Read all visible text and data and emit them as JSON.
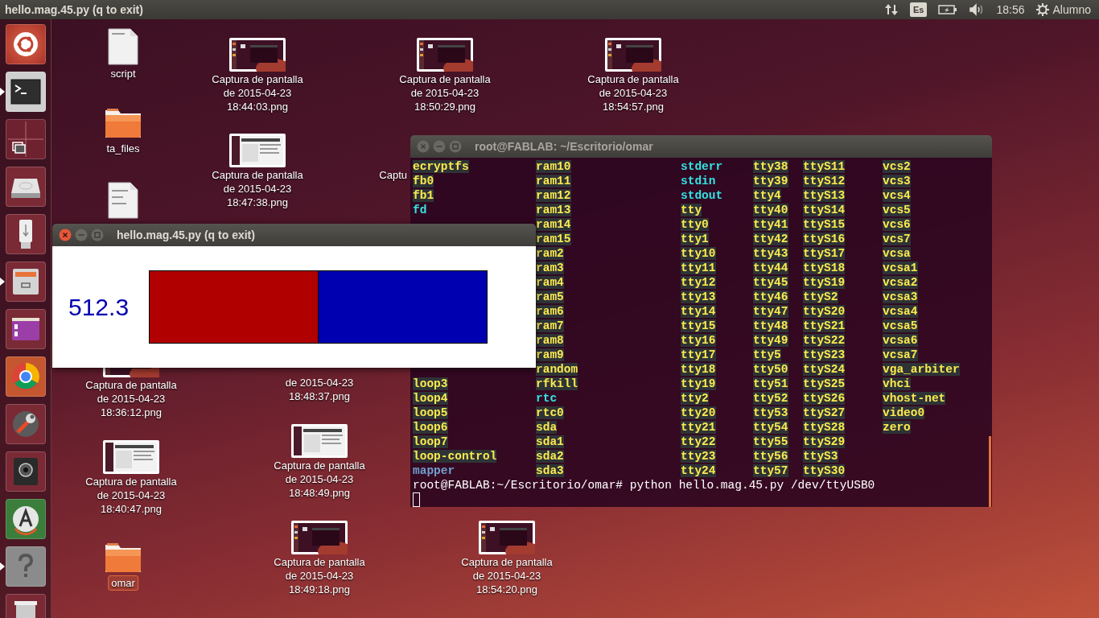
{
  "top_panel": {
    "title": "hello.mag.45.py (q to exit)",
    "keyboard_layout": "Es",
    "clock": "18:56",
    "user": "Alumno"
  },
  "launcher": [
    {
      "kind": "dash",
      "running": false
    },
    {
      "kind": "terminal",
      "running": true
    },
    {
      "kind": "workspaces",
      "running": false
    },
    {
      "kind": "drive",
      "running": false
    },
    {
      "kind": "usb",
      "running": false
    },
    {
      "kind": "files",
      "running": true
    },
    {
      "kind": "purple",
      "running": false
    },
    {
      "kind": "browser",
      "running": false
    },
    {
      "kind": "settings",
      "running": false
    },
    {
      "kind": "camera",
      "running": false
    },
    {
      "kind": "updater",
      "running": false
    },
    {
      "kind": "help",
      "running": true
    },
    {
      "kind": "trash",
      "running": false
    }
  ],
  "desktop_icons": [
    {
      "kind": "file",
      "label": "script",
      "selected": false
    },
    {
      "kind": "folder",
      "label": "ta_files",
      "selected": false
    },
    {
      "kind": "html"
    },
    {
      "kind": "screenshot",
      "label": "Captura de pantalla\nde 2015-04-23\n18:44:03.png",
      "selected": false
    },
    {
      "kind": "screenshot",
      "label": "Captura de pantalla\nde 2015-04-23\n18:47:38.png",
      "selected": false
    },
    {
      "kind": "screenshot",
      "label": "Captura de pantalla\nde 2015-04-23\n18:50:29.png",
      "selected": false
    },
    {
      "kind": "screenshot",
      "label": "Captura de pantalla\nde 2015-04-23\n18:54:57.png",
      "selected": false
    },
    {
      "kind": "partial",
      "label": "Captu",
      "selected": false
    },
    {
      "kind": "screenshot",
      "label": "Captura de pantalla\nde 2015-04-23\n18:36:12.png",
      "selected": false
    },
    {
      "kind": "label",
      "label": "de 2015-04-23\n18:48:37.png",
      "selected": false
    },
    {
      "kind": "screenshot",
      "label": "Captura de pantalla\nde 2015-04-23\n18:40:47.png",
      "selected": false
    },
    {
      "kind": "screenshot",
      "label": "Captura de pantalla\nde 2015-04-23\n18:48:49.png",
      "selected": false
    },
    {
      "kind": "folder",
      "label": "omar",
      "selected": true
    },
    {
      "kind": "screenshot",
      "label": "Captura de pantalla\nde 2015-04-23\n18:49:18.png",
      "selected": false
    },
    {
      "kind": "screenshot",
      "label": "Captura de pantalla\nde 2015-04-23\n18:54:20.png",
      "selected": false
    }
  ],
  "terminal_window": {
    "title": "root@FABLAB: ~/Escritorio/omar",
    "columns": [
      {
        "top": [
          {
            "name": "ecryptfs",
            "kind": "device"
          },
          {
            "name": "fb0",
            "kind": "device"
          },
          {
            "name": "fb1",
            "kind": "device"
          },
          {
            "name": "fd",
            "kind": "link"
          }
        ],
        "bottom": [
          {
            "name": "loop3",
            "kind": "device"
          },
          {
            "name": "loop4",
            "kind": "device"
          },
          {
            "name": "loop5",
            "kind": "device"
          },
          {
            "name": "loop6",
            "kind": "device"
          },
          {
            "name": "loop7",
            "kind": "device"
          },
          {
            "name": "loop-control",
            "kind": "device"
          },
          {
            "name": "mapper",
            "kind": "dir"
          }
        ]
      },
      {
        "top": [
          {
            "name": "ram10",
            "kind": "device"
          },
          {
            "name": "ram11",
            "kind": "device"
          },
          {
            "name": "ram12",
            "kind": "device"
          },
          {
            "name": "ram13",
            "kind": "device"
          },
          {
            "name": "ram14",
            "kind": "device"
          },
          {
            "name": "ram15",
            "kind": "device"
          },
          {
            "name": "ram2",
            "kind": "device"
          },
          {
            "name": "ram3",
            "kind": "device"
          },
          {
            "name": "ram4",
            "kind": "device"
          },
          {
            "name": "ram5",
            "kind": "device"
          },
          {
            "name": "ram6",
            "kind": "device"
          },
          {
            "name": "ram7",
            "kind": "device"
          },
          {
            "name": "ram8",
            "kind": "device"
          },
          {
            "name": "ram9",
            "kind": "device"
          },
          {
            "name": "random",
            "kind": "device"
          },
          {
            "name": "rfkill",
            "kind": "device"
          },
          {
            "name": "rtc",
            "kind": "link"
          },
          {
            "name": "rtc0",
            "kind": "device"
          },
          {
            "name": "sda",
            "kind": "device"
          },
          {
            "name": "sda1",
            "kind": "device"
          },
          {
            "name": "sda2",
            "kind": "device"
          },
          {
            "name": "sda3",
            "kind": "device"
          }
        ]
      },
      {
        "top": [
          {
            "name": "stderr",
            "kind": "link"
          },
          {
            "name": "stdin",
            "kind": "link"
          },
          {
            "name": "stdout",
            "kind": "link"
          },
          {
            "name": "tty",
            "kind": "device"
          },
          {
            "name": "tty0",
            "kind": "device"
          },
          {
            "name": "tty1",
            "kind": "device"
          },
          {
            "name": "tty10",
            "kind": "device"
          },
          {
            "name": "tty11",
            "kind": "device"
          },
          {
            "name": "tty12",
            "kind": "device"
          },
          {
            "name": "tty13",
            "kind": "device"
          },
          {
            "name": "tty14",
            "kind": "device"
          },
          {
            "name": "tty15",
            "kind": "device"
          },
          {
            "name": "tty16",
            "kind": "device"
          },
          {
            "name": "tty17",
            "kind": "device"
          },
          {
            "name": "tty18",
            "kind": "device"
          },
          {
            "name": "tty19",
            "kind": "device"
          },
          {
            "name": "tty2",
            "kind": "device"
          },
          {
            "name": "tty20",
            "kind": "device"
          },
          {
            "name": "tty21",
            "kind": "device"
          },
          {
            "name": "tty22",
            "kind": "device"
          },
          {
            "name": "tty23",
            "kind": "device"
          },
          {
            "name": "tty24",
            "kind": "device"
          }
        ]
      },
      {
        "top": [
          {
            "name": "tty38",
            "kind": "device"
          },
          {
            "name": "tty39",
            "kind": "device"
          },
          {
            "name": "tty4",
            "kind": "device"
          },
          {
            "name": "tty40",
            "kind": "device"
          },
          {
            "name": "tty41",
            "kind": "device"
          },
          {
            "name": "tty42",
            "kind": "device"
          },
          {
            "name": "tty43",
            "kind": "device"
          },
          {
            "name": "tty44",
            "kind": "device"
          },
          {
            "name": "tty45",
            "kind": "device"
          },
          {
            "name": "tty46",
            "kind": "device"
          },
          {
            "name": "tty47",
            "kind": "device"
          },
          {
            "name": "tty48",
            "kind": "device"
          },
          {
            "name": "tty49",
            "kind": "device"
          },
          {
            "name": "tty5",
            "kind": "device"
          },
          {
            "name": "tty50",
            "kind": "device"
          },
          {
            "name": "tty51",
            "kind": "device"
          },
          {
            "name": "tty52",
            "kind": "device"
          },
          {
            "name": "tty53",
            "kind": "device"
          },
          {
            "name": "tty54",
            "kind": "device"
          },
          {
            "name": "tty55",
            "kind": "device"
          },
          {
            "name": "tty56",
            "kind": "device"
          },
          {
            "name": "tty57",
            "kind": "device"
          }
        ]
      },
      {
        "top": [
          {
            "name": "ttyS11",
            "kind": "device"
          },
          {
            "name": "ttyS12",
            "kind": "device"
          },
          {
            "name": "ttyS13",
            "kind": "device"
          },
          {
            "name": "ttyS14",
            "kind": "device"
          },
          {
            "name": "ttyS15",
            "kind": "device"
          },
          {
            "name": "ttyS16",
            "kind": "device"
          },
          {
            "name": "ttyS17",
            "kind": "device"
          },
          {
            "name": "ttyS18",
            "kind": "device"
          },
          {
            "name": "ttyS19",
            "kind": "device"
          },
          {
            "name": "ttyS2",
            "kind": "device"
          },
          {
            "name": "ttyS20",
            "kind": "device"
          },
          {
            "name": "ttyS21",
            "kind": "device"
          },
          {
            "name": "ttyS22",
            "kind": "device"
          },
          {
            "name": "ttyS23",
            "kind": "device"
          },
          {
            "name": "ttyS24",
            "kind": "device"
          },
          {
            "name": "ttyS25",
            "kind": "device"
          },
          {
            "name": "ttyS26",
            "kind": "device"
          },
          {
            "name": "ttyS27",
            "kind": "device"
          },
          {
            "name": "ttyS28",
            "kind": "device"
          },
          {
            "name": "ttyS29",
            "kind": "device"
          },
          {
            "name": "ttyS3",
            "kind": "device"
          },
          {
            "name": "ttyS30",
            "kind": "device"
          }
        ]
      },
      {
        "top": [
          {
            "name": "vcs2",
            "kind": "device"
          },
          {
            "name": "vcs3",
            "kind": "device"
          },
          {
            "name": "vcs4",
            "kind": "device"
          },
          {
            "name": "vcs5",
            "kind": "device"
          },
          {
            "name": "vcs6",
            "kind": "device"
          },
          {
            "name": "vcs7",
            "kind": "device"
          },
          {
            "name": "vcsa",
            "kind": "device"
          },
          {
            "name": "vcsa1",
            "kind": "device"
          },
          {
            "name": "vcsa2",
            "kind": "device"
          },
          {
            "name": "vcsa3",
            "kind": "device"
          },
          {
            "name": "vcsa4",
            "kind": "device"
          },
          {
            "name": "vcsa5",
            "kind": "device"
          },
          {
            "name": "vcsa6",
            "kind": "device"
          },
          {
            "name": "vcsa7",
            "kind": "device"
          },
          {
            "name": "vga_arbiter",
            "kind": "device"
          },
          {
            "name": "vhci",
            "kind": "device"
          },
          {
            "name": "vhost-net",
            "kind": "device"
          },
          {
            "name": "video0",
            "kind": "device"
          },
          {
            "name": "zero",
            "kind": "device"
          }
        ]
      }
    ],
    "prompt": "root@FABLAB:~/Escritorio/omar# python hello.mag.45.py /dev/ttyUSB0"
  },
  "mag_window": {
    "title": "hello.mag.45.py (q to exit)",
    "reading": "512.3",
    "level": 0.5
  }
}
